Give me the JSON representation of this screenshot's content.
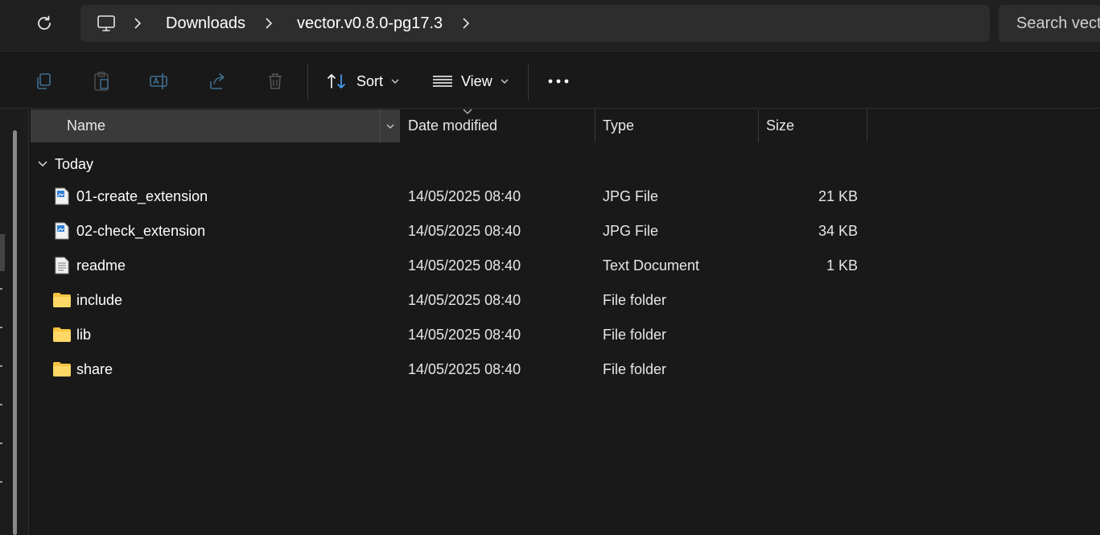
{
  "address_bar": {
    "refresh_icon": "refresh-icon",
    "pc_icon": "computer-icon",
    "breadcrumbs": [
      "Downloads",
      "vector.v0.8.0-pg17.3"
    ],
    "search_placeholder": "Search vect"
  },
  "command_bar": {
    "icons": [
      "copy-icon",
      "paste-icon",
      "rename-icon",
      "share-icon",
      "delete-icon"
    ],
    "sort_label": "Sort",
    "view_label": "View",
    "more_icon": "more-icon"
  },
  "columns": {
    "name": "Name",
    "date_modified": "Date modified",
    "type": "Type",
    "size": "Size"
  },
  "group": {
    "label": "Today"
  },
  "files": [
    {
      "name": "01-create_extension",
      "date": "14/05/2025 08:40",
      "type": "JPG File",
      "size": "21 KB",
      "icon": "image-file-icon"
    },
    {
      "name": "02-check_extension",
      "date": "14/05/2025 08:40",
      "type": "JPG File",
      "size": "34 KB",
      "icon": "image-file-icon"
    },
    {
      "name": "readme",
      "date": "14/05/2025 08:40",
      "type": "Text Document",
      "size": "1 KB",
      "icon": "text-file-icon"
    },
    {
      "name": "include",
      "date": "14/05/2025 08:40",
      "type": "File folder",
      "size": "",
      "icon": "folder-icon"
    },
    {
      "name": "lib",
      "date": "14/05/2025 08:40",
      "type": "File folder",
      "size": "",
      "icon": "folder-icon"
    },
    {
      "name": "share",
      "date": "14/05/2025 08:40",
      "type": "File folder",
      "size": "",
      "icon": "folder-icon"
    }
  ],
  "colors": {
    "background": "#191919",
    "topbar": "#202020",
    "address_bg": "#2d2d2d",
    "folder_yellow": "#f6c342",
    "accent_blue": "#4aa3ff"
  }
}
